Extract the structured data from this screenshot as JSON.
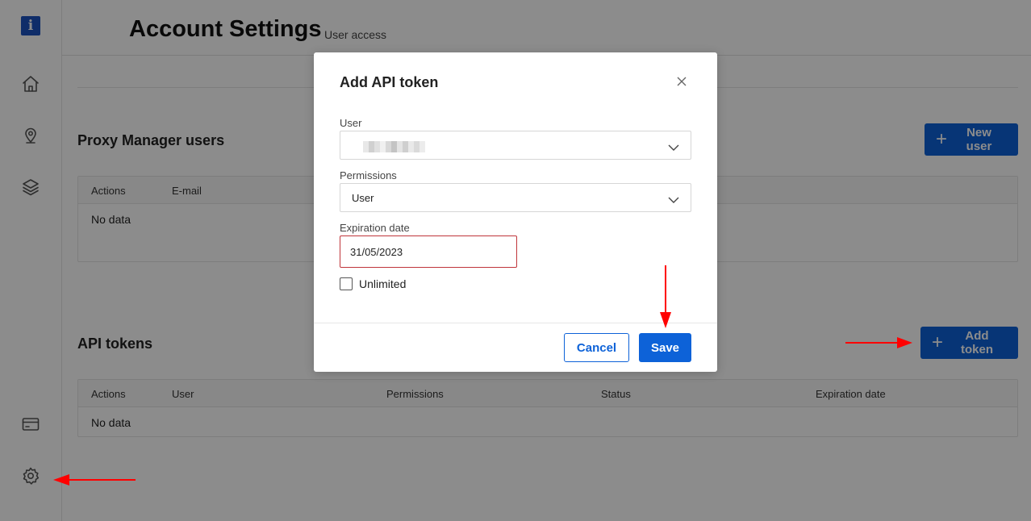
{
  "header": {
    "title": "Account Settings",
    "subtitle": "User access"
  },
  "sidebar": {
    "logo_glyph": "i",
    "items": [
      {
        "icon": "home-icon"
      },
      {
        "icon": "location-pin-icon"
      },
      {
        "icon": "layers-icon"
      },
      {
        "icon": "billing-card-icon"
      },
      {
        "icon": "gear-icon"
      }
    ]
  },
  "users_section": {
    "title": "Proxy Manager users",
    "new_button": "New user",
    "columns": [
      "Actions",
      "E-mail"
    ],
    "empty_text": "No data"
  },
  "tokens_section": {
    "title": "API tokens",
    "add_button": "Add token",
    "columns": [
      "Actions",
      "User",
      "Permissions",
      "Status",
      "Expiration date"
    ],
    "empty_text": "No data"
  },
  "modal": {
    "title": "Add API token",
    "user_label": "User",
    "permissions_label": "Permissions",
    "permissions_value": "User",
    "expiration_label": "Expiration date",
    "expiration_value": "31/05/2023",
    "unlimited_label": "Unlimited",
    "cancel_label": "Cancel",
    "save_label": "Save"
  },
  "colors": {
    "primary": "#0d62d8",
    "error_border": "#c0353b",
    "annotation_arrow": "#ff0000"
  }
}
